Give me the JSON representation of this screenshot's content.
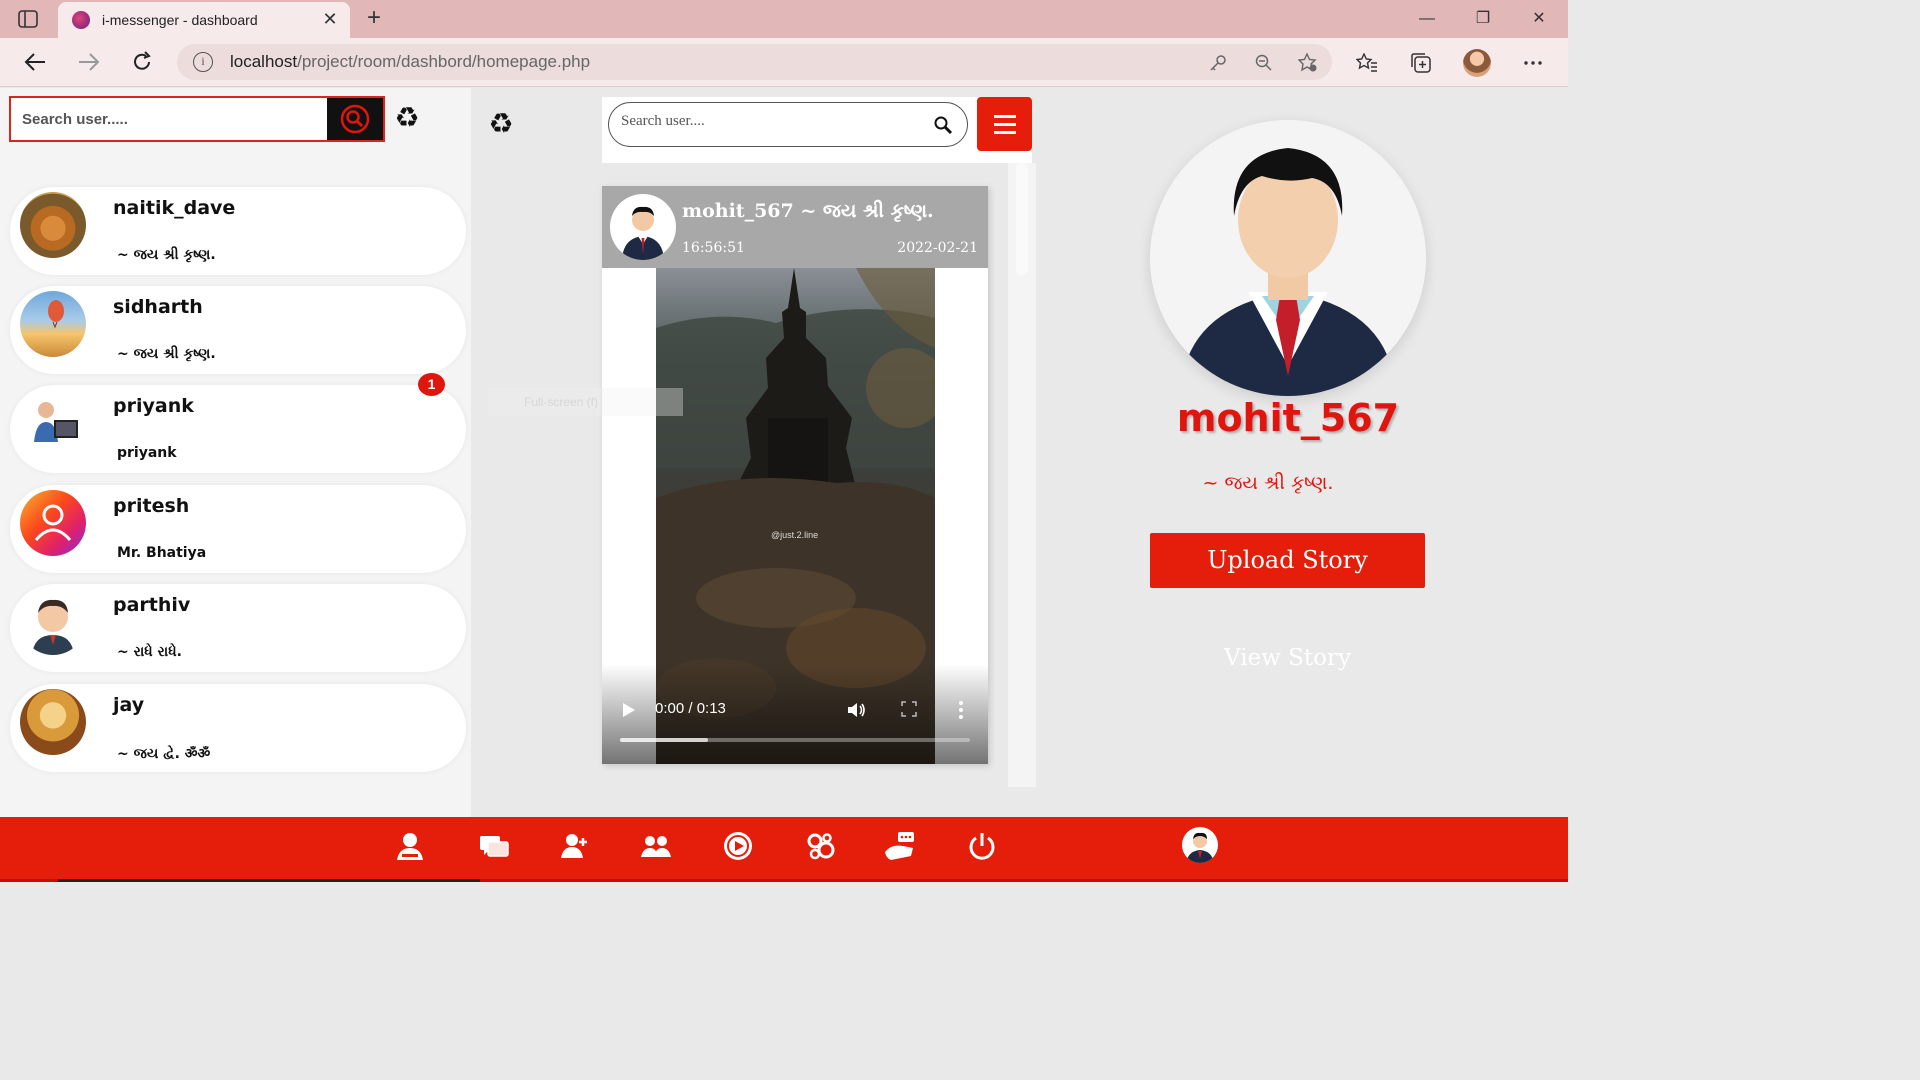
{
  "browser": {
    "tab_title": "i-messenger - dashboard",
    "url_host": "localhost",
    "url_path": "/project/room/dashbord/homepage.php"
  },
  "sidebar": {
    "search_placeholder": "Search user.....",
    "contacts": [
      {
        "name": "naitik_dave",
        "status": "~ જય શ્રી કૃષ્ણ."
      },
      {
        "name": "sidharth",
        "status": "~ જય શ્રી કૃષ્ણ."
      },
      {
        "name": "priyank",
        "status": "priyank"
      },
      {
        "name": "pritesh",
        "status": "Mr. Bhatiya"
      },
      {
        "name": "parthiv",
        "status": "~ રાધે રાધે."
      },
      {
        "name": "jay",
        "status": "~ જય દ્વે. ॐॐ"
      }
    ],
    "unread_count": "1"
  },
  "feed": {
    "search_placeholder": "Search user....",
    "post": {
      "user": "mohit_567 ~ જય શ્રી કૃષ્ણ.",
      "time": "16:56:51",
      "date": "2022-02-21",
      "video_watermark": "@just.2.line",
      "video_time": "0:00 / 0:13",
      "progress": 0.25
    },
    "tooltip": "Full-screen (f)"
  },
  "profile": {
    "username": "mohit_567",
    "status": "~ જય શ્રી કૃષ્ણ.",
    "upload_label": "Upload Story",
    "view_label": "View Story"
  },
  "colors": {
    "accent": "#e41e0a",
    "tabbar": "#e2b7b8"
  },
  "bottom_nav": {
    "icons": [
      "profile-icon",
      "chats-icon",
      "add-user-icon",
      "groups-icon",
      "video-icon",
      "settings-icon",
      "story-icon",
      "power-icon",
      "avatar"
    ]
  }
}
